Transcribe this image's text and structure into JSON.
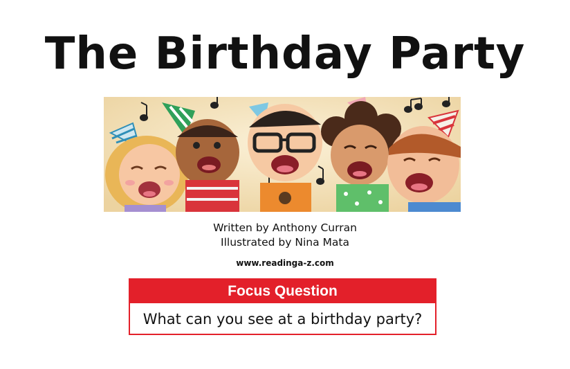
{
  "cover": {
    "title": "The Birthday Party",
    "written_by": "Written by Anthony Curran",
    "illustrated_by": "Illustrated by Nina Mata",
    "website": "www.readinga-z.com"
  },
  "focus": {
    "header": "Focus Question",
    "question": "What can you see at a birthday party?"
  },
  "colors": {
    "accent_red": "#e3202a",
    "illustration_bg": "#f3e3bd"
  }
}
